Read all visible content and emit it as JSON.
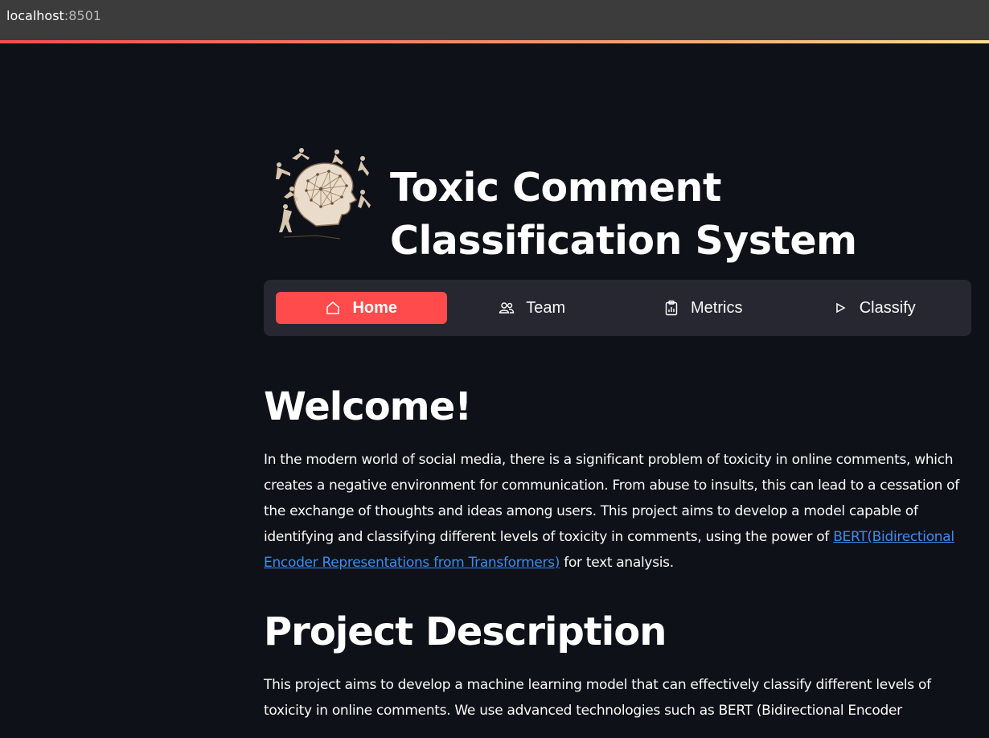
{
  "browser": {
    "url_host": "localhost",
    "url_port": ":8501"
  },
  "header": {
    "title": "Toxic Comment Classification System",
    "logo_icon": "brain-fighters-logo-icon"
  },
  "nav": {
    "items": [
      {
        "label": "Home",
        "icon": "home-icon",
        "active": true
      },
      {
        "label": "Team",
        "icon": "people-icon",
        "active": false
      },
      {
        "label": "Metrics",
        "icon": "clipboard-chart-icon",
        "active": false
      },
      {
        "label": "Classify",
        "icon": "play-icon",
        "active": false
      }
    ],
    "active_color": "#ff4b4b"
  },
  "welcome": {
    "heading": "Welcome!",
    "text_before_link": "In the modern world of social media, there is a significant problem of toxicity in online comments, which creates a negative environment for communication. From abuse to insults, this can lead to a cessation of the exchange of thoughts and ideas among users. This project aims to develop a model capable of identifying and classifying different levels of toxicity in comments, using the power of ",
    "link_text": "BERT(Bidirectional Encoder Representations from Transformers)",
    "text_after_link": " for text analysis."
  },
  "project": {
    "heading": "Project Description",
    "text": "This project aims to develop a machine learning model that can effectively classify different levels of toxicity in online comments. We use advanced technologies such as BERT (Bidirectional Encoder"
  },
  "colors": {
    "background": "#0e1117",
    "navbar": "#262730",
    "link": "#3b8df2"
  }
}
